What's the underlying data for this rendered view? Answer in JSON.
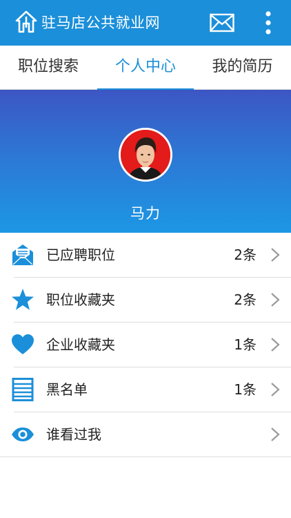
{
  "appbar": {
    "title": "驻马店公共就业网",
    "logo_icon": "house-logo-icon",
    "mail_icon": "mail-icon",
    "more_icon": "more-vert-icon",
    "background": "#1b8fd9"
  },
  "tabs": [
    {
      "label": "职位搜索",
      "active": false
    },
    {
      "label": "个人中心",
      "active": true
    },
    {
      "label": "我的简历",
      "active": false
    }
  ],
  "profile": {
    "name": "马力",
    "avatar_background": "#e31b1b"
  },
  "menu": [
    {
      "label": "已应聘职位",
      "count": "2条",
      "icon": "envelope-open-icon"
    },
    {
      "label": "职位收藏夹",
      "count": "2条",
      "icon": "star-icon"
    },
    {
      "label": "企业收藏夹",
      "count": "1条",
      "icon": "heart-icon"
    },
    {
      "label": "黑名单",
      "count": "1条",
      "icon": "list-icon"
    },
    {
      "label": "谁看过我",
      "count": "",
      "icon": "eye-icon"
    }
  ],
  "accent_color": "#1b8fd9"
}
